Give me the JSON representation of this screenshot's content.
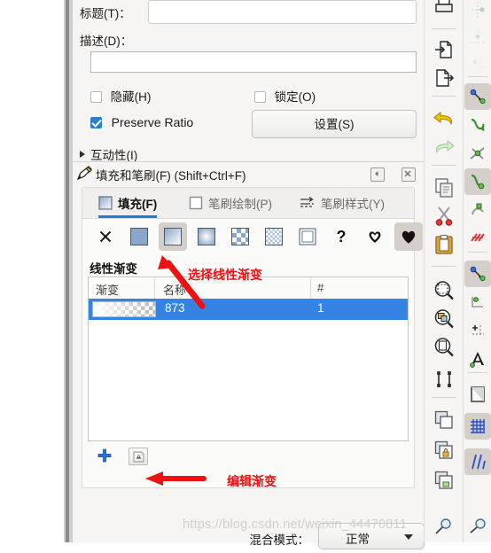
{
  "app": "Inkscape - Fill and Stroke dialog",
  "object_properties": {
    "title_label": "标题(T)：",
    "title_value": "",
    "title_placeholder": "",
    "desc_label": "描述(D)：",
    "desc_value": "",
    "desc_placeholder": "",
    "hide_label": "隐藏(H)",
    "hide_checked": false,
    "lock_label": "锁定(O)",
    "lock_checked": false,
    "preserve_ratio_label": "Preserve Ratio",
    "preserve_ratio_checked": true,
    "settings_button": "设置(S)",
    "interactivity_label": "互动性(I)"
  },
  "dialog": {
    "title": "填充和笔刷(F) (Shift+Ctrl+F)",
    "collapse_tooltip": "◀",
    "close_tooltip": "✕",
    "tabs": [
      {
        "label": "填充(F)",
        "icon": "gradient-square-icon",
        "active": true
      },
      {
        "label": "笔刷绘制(P)",
        "icon": "empty-square-icon",
        "active": false
      },
      {
        "label": "笔刷样式(Y)",
        "icon": "dashed-lines-icon",
        "active": false
      }
    ],
    "fill_types": [
      {
        "name": "no-paint",
        "icon": "x-icon",
        "selected": false
      },
      {
        "name": "flat-color",
        "icon": "flat-square-icon",
        "selected": false
      },
      {
        "name": "linear-gradient",
        "icon": "linear-gradient-icon",
        "selected": true
      },
      {
        "name": "radial-gradient",
        "icon": "radial-gradient-icon",
        "selected": false
      },
      {
        "name": "pattern",
        "icon": "checker-pattern-icon",
        "selected": false
      },
      {
        "name": "swatch",
        "icon": "swatch-pattern-icon",
        "selected": false
      },
      {
        "name": "mesh-gradient",
        "icon": "mesh-square-icon",
        "selected": false
      },
      {
        "name": "unknown-paint",
        "icon": "question-mark-icon",
        "selected": false
      },
      {
        "name": "even-odd-fillrule",
        "icon": "evenodd-heart-icon",
        "selected": false
      },
      {
        "name": "nonzero-fillrule",
        "icon": "nonzero-heart-icon",
        "selected": true
      }
    ],
    "gradient_section_label": "线性渐变",
    "list_headers": [
      "渐变",
      "名称",
      "#"
    ],
    "rows": [
      {
        "swatch": "white-to-transparent-gradient",
        "name": "873",
        "count": "1",
        "selected": true
      }
    ],
    "add_button_icon": "plus-icon",
    "edit_gradient_button_icon": "edit-gradient-icon",
    "blend_mode_label": "混合模式：",
    "blend_mode_value": "正常"
  },
  "annotations": [
    {
      "text": "选择线性渐变",
      "id": "annotation-select-linear-gradient"
    },
    {
      "text": "编辑渐变",
      "id": "annotation-edit-gradient"
    }
  ],
  "command_bar": [
    {
      "name": "print-icon"
    },
    {
      "name": "import-icon"
    },
    {
      "name": "export-icon"
    },
    {
      "name": "undo-icon"
    },
    {
      "name": "redo-icon"
    },
    {
      "name": "copy-icon"
    },
    {
      "name": "cut-icon"
    },
    {
      "name": "paste-icon"
    },
    {
      "name": "zoom-selection-icon"
    },
    {
      "name": "zoom-drawing-icon"
    },
    {
      "name": "zoom-page-icon"
    },
    {
      "name": "selector-tool-icon"
    },
    {
      "name": "duplicate-icon"
    },
    {
      "name": "group-lock-icon"
    },
    {
      "name": "ungroup-icon"
    },
    {
      "name": "object-properties-icon"
    }
  ],
  "snap_bar": [
    {
      "name": "snap-bounding-box-icon",
      "enabled": false
    },
    {
      "name": "snap-bbox-edge-icon",
      "enabled": false
    },
    {
      "name": "snap-bbox-corner-icon",
      "enabled": false
    },
    {
      "name": "snap-nodes-icon",
      "enabled": true
    },
    {
      "name": "snap-path-icon",
      "enabled": false
    },
    {
      "name": "snap-path-intersection-icon",
      "enabled": false
    },
    {
      "name": "snap-cusp-node-icon",
      "enabled": true
    },
    {
      "name": "snap-smooth-node-icon",
      "enabled": false
    },
    {
      "name": "snap-midpoint-icon",
      "enabled": false
    },
    {
      "name": "snap-others-icon",
      "enabled": true
    },
    {
      "name": "snap-bbox-center-icon",
      "enabled": false
    },
    {
      "name": "snap-object-center-icon",
      "enabled": false
    },
    {
      "name": "snap-text-baseline-icon",
      "enabled": false
    },
    {
      "name": "snap-page-border-icon",
      "enabled": false
    },
    {
      "name": "snap-grid-icon",
      "enabled": true
    },
    {
      "name": "snap-guide-icon",
      "enabled": true
    }
  ],
  "watermark": "https://blog.csdn.net/weixin_44470811"
}
